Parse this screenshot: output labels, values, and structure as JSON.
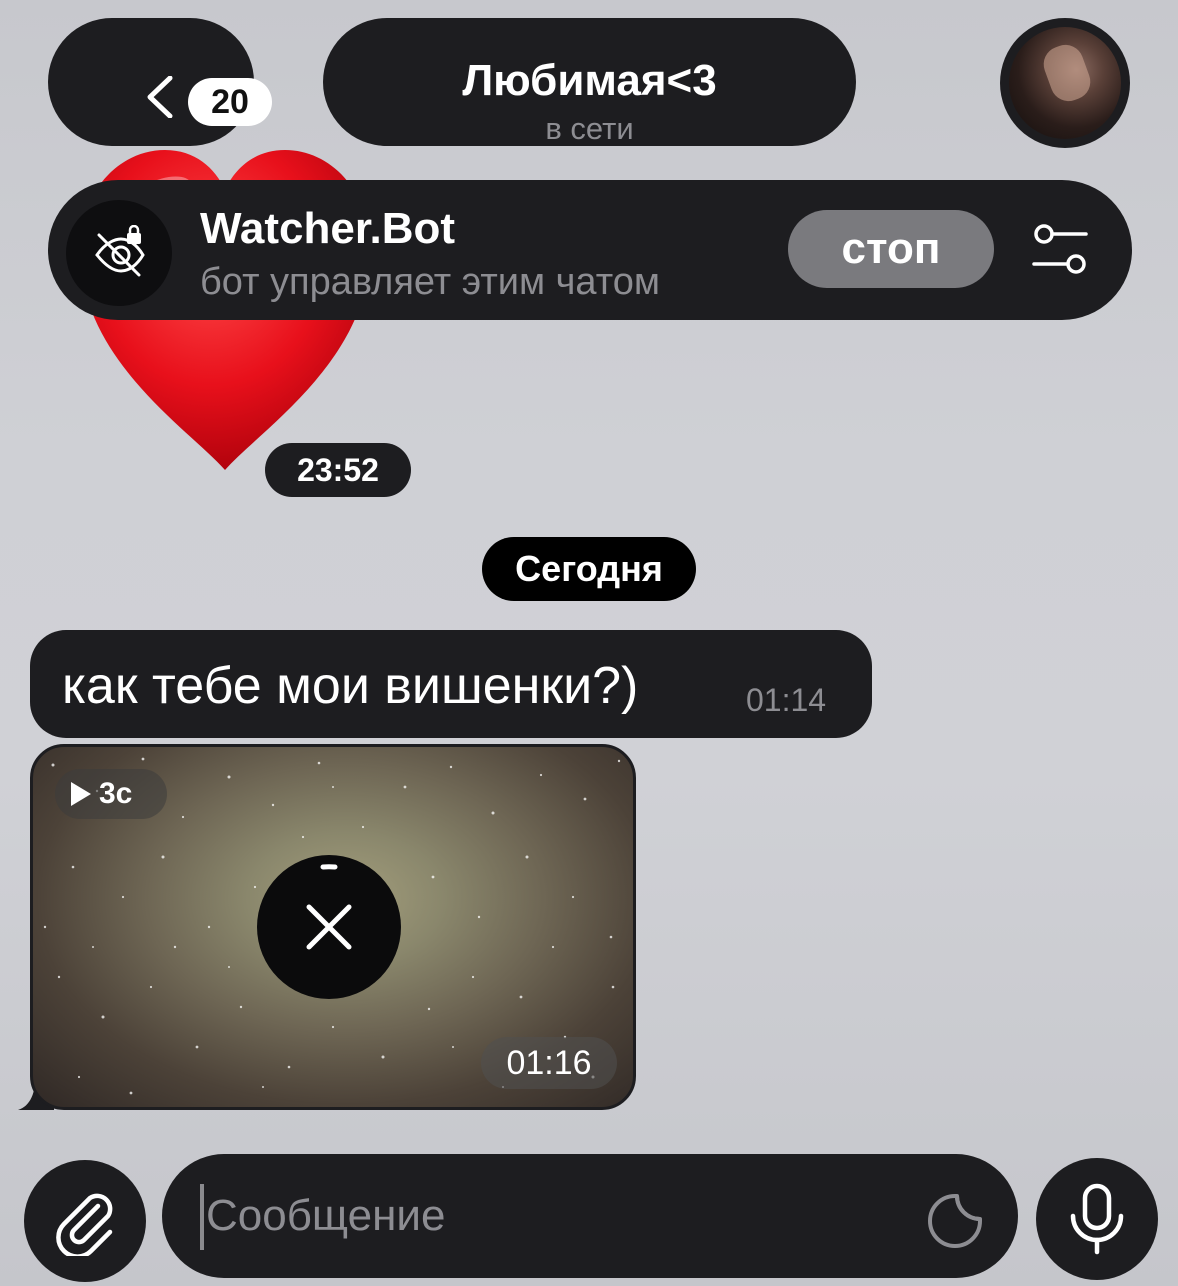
{
  "header": {
    "unread_count": "20",
    "chat_title": "Любимая<3",
    "chat_status": "в сети"
  },
  "bot_banner": {
    "name": "Watcher.Bot",
    "subtitle": "бот управляет этим чатом",
    "stop_label": "стоп"
  },
  "messages": {
    "sticker_time": "23:52",
    "date_separator": "Сегодня",
    "text_message": "как тебе мои вишенки?)",
    "text_time": "01:14",
    "video_duration": "3с",
    "video_time": "01:16"
  },
  "composer": {
    "placeholder": "Сообщение"
  },
  "colors": {
    "bar_background": "#1d1d20",
    "accent_red": "#e8101b",
    "secondary_text": "#8d8d92"
  }
}
